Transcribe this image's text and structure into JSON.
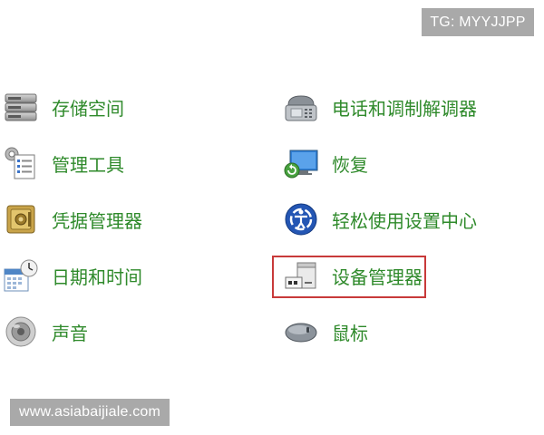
{
  "watermark": {
    "top_tag": "TG: MYYJJPP",
    "bottom_tag": "www.asiabaijiale.com"
  },
  "colors": {
    "link_green": "#2f8a2b",
    "highlight_red": "#c83a3a",
    "tag_gray": "#a9a9a9"
  },
  "left_items": [
    {
      "label": "存储空间",
      "icon": "storage-spaces-icon"
    },
    {
      "label": "管理工具",
      "icon": "admin-tools-icon"
    },
    {
      "label": "凭据管理器",
      "icon": "credential-manager-icon"
    },
    {
      "label": "日期和时间",
      "icon": "date-time-icon"
    },
    {
      "label": "声音",
      "icon": "sound-icon"
    }
  ],
  "right_items": [
    {
      "label": "电话和调制解调器",
      "icon": "phone-modem-icon"
    },
    {
      "label": "恢复",
      "icon": "recovery-icon"
    },
    {
      "label": "轻松使用设置中心",
      "icon": "ease-of-access-icon"
    },
    {
      "label": "设备管理器",
      "icon": "device-manager-icon",
      "highlighted": true
    },
    {
      "label": "鼠标",
      "icon": "mouse-icon"
    }
  ]
}
